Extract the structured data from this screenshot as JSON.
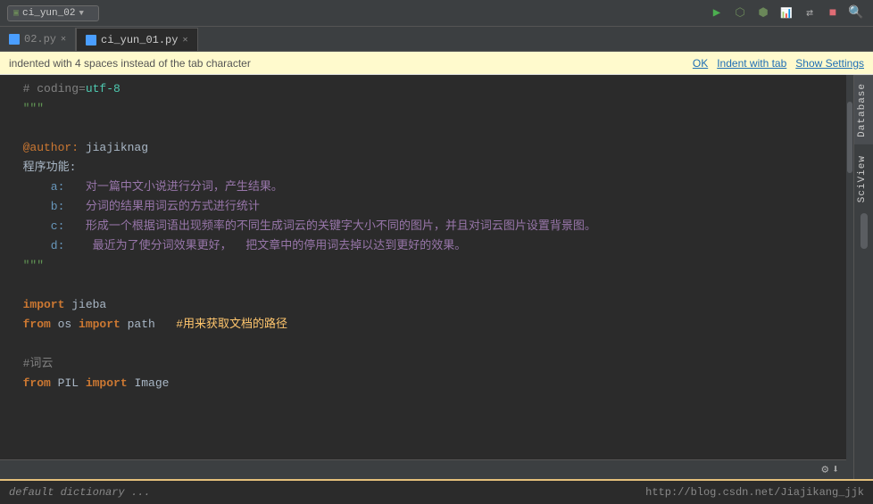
{
  "toolbar": {
    "file_dropdown": "ci_yun_02",
    "btn_run": "▶",
    "btn_debug": "⚙",
    "btn_stop": "⛔",
    "btn_profile": "📊",
    "btn_something": "🔧",
    "btn_red": "🔴",
    "btn_search": "🔍"
  },
  "tabs": [
    {
      "name": "02.py",
      "active": false,
      "closable": true
    },
    {
      "name": "ci_yun_01.py",
      "active": true,
      "closable": true
    }
  ],
  "notification": {
    "text": "indented with 4 spaces instead of the tab character",
    "ok_label": "OK",
    "indent_label": "Indent with tab",
    "settings_label": "Show Settings"
  },
  "sidebar": {
    "database_label": "Database",
    "sciview_label": "SciView"
  },
  "code": {
    "line1": "  # coding=utf-8",
    "line2": "  \"\"\"",
    "line3": "",
    "line4": "  @author: jiajiknag",
    "line5": "  程序功能:",
    "line6": "      a:   对一篇中文小说进行分词，产生结果。",
    "line7": "      b:   分词的结果用词云的方式进行统计",
    "line8": "      c:   形成一个根据词语出现频率的不同生成词云的关键字大小不同的图片，并且对词云图片设置背景图。",
    "line9": "      d:   最近为了使分词效果更好，  把文章中的停用词去掉以达到更好的效果。",
    "line10": "  \"\"\"",
    "line11": "",
    "line12": "  import jieba",
    "line13": "  from os import path   #用来获取文档的路径",
    "line14": "",
    "line15": "  #词云",
    "line16": "  from PIL import Image"
  },
  "status_bar": {
    "settings_icon": "⚙",
    "download_icon": "⬇"
  },
  "bottom_bar": {
    "left_text": "default dictionary ...",
    "right_text": "http://blog.csdn.net/Jiajikang_jjk"
  }
}
